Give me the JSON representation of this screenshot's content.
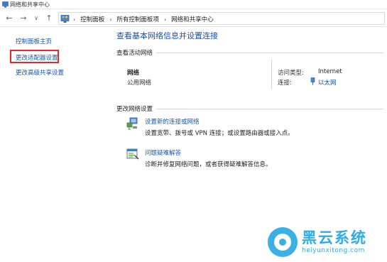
{
  "window": {
    "title": "网络和共享中心"
  },
  "navbar": {
    "back_glyph": "←",
    "forward_glyph": "→",
    "dropdown_glyph": "∨",
    "up_glyph": "↑",
    "breadcrumbs": [
      "控制面板",
      "所有控制面板项",
      "网络和共享中心"
    ],
    "separator": "›"
  },
  "sidebar": {
    "items": [
      {
        "label": "控制面板主页"
      },
      {
        "label": "更改适配器设置"
      },
      {
        "label": "更改高级共享设置"
      }
    ]
  },
  "main": {
    "title": "查看基本网络信息并设置连接",
    "active_section": "查看活动网络",
    "network": {
      "name": "网络",
      "type": "公用网络",
      "access_label": "访问类型:",
      "access_value": "Internet",
      "conn_label": "连接:",
      "conn_value": "以太网"
    },
    "change_section": "更改网络设置",
    "tasks": [
      {
        "link": "设置新的连接或网络",
        "desc": "设置宽带、拨号或 VPN 连接；或设置路由器或接入点。",
        "icon": "network-setup-icon"
      },
      {
        "link": "问题疑难解答",
        "desc": "诊断并修复网络问题，或者获得疑难解答信息。",
        "icon": "troubleshoot-icon"
      }
    ]
  },
  "watermark": {
    "text": "黑云系统",
    "sub": "heiyunxitong.com"
  },
  "colors": {
    "link": "#1a56a8",
    "title": "#1e4fa0",
    "highlight": "#e8262b",
    "watermark": "#1aa3e0"
  }
}
